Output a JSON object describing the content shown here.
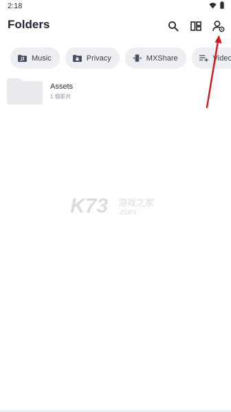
{
  "status": {
    "time": "2:18",
    "icons": [
      "wifi-icon",
      "battery-icon"
    ]
  },
  "header": {
    "title": "Folders",
    "actions": [
      "search-icon",
      "view-layout-icon",
      "account-icon"
    ]
  },
  "chips": [
    {
      "label": "Music",
      "icon": "music-folder-icon"
    },
    {
      "label": "Privacy",
      "icon": "lock-folder-icon"
    },
    {
      "label": "MXShare",
      "icon": "share-icon"
    },
    {
      "label": "Video",
      "icon": "playlist-icon"
    }
  ],
  "folders": [
    {
      "name": "Assets",
      "count": "1 個影片"
    }
  ],
  "watermark": {
    "text_cn": "游戏之家",
    "text_url": ".com"
  },
  "colors": {
    "chip_bg": "#eceef1",
    "folder": "#e8eaed",
    "accent_red": "#d6141c"
  }
}
